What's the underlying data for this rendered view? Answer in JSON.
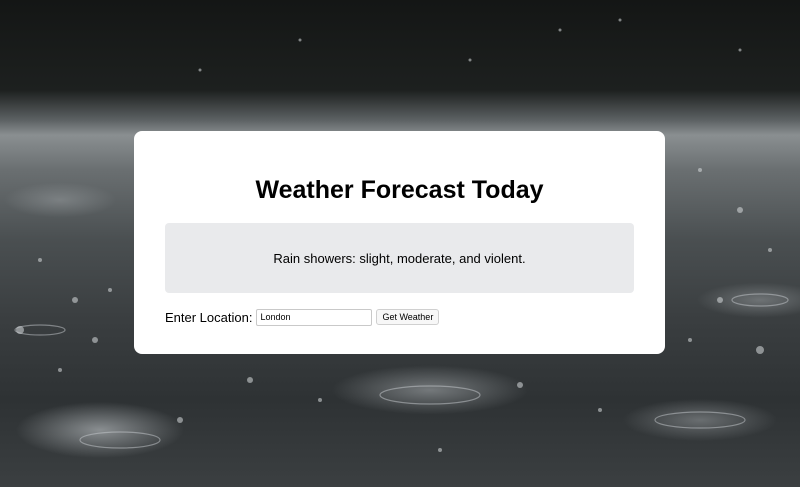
{
  "page": {
    "title": "Weather Forecast Today"
  },
  "forecast": {
    "description": "Rain showers: slight, moderate, and violent."
  },
  "location": {
    "label": "Enter Location:",
    "input_value": "London",
    "button_label": "Get Weather"
  },
  "colors": {
    "card_background": "#ffffff",
    "forecast_box_background": "#e9eaec",
    "text": "#000000"
  },
  "background_image": "rain-on-pavement"
}
